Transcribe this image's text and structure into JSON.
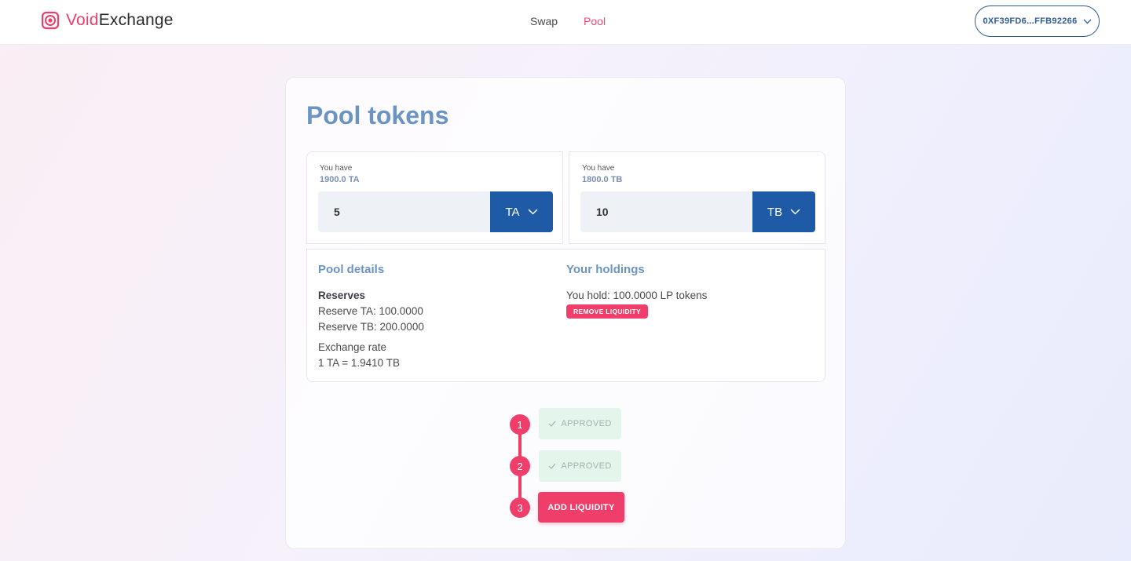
{
  "header": {
    "logo_prefix": "Void",
    "logo_suffix": "Exchange",
    "nav": [
      {
        "label": "Swap",
        "active": false
      },
      {
        "label": "Pool",
        "active": true
      }
    ],
    "wallet_address": "0XF39FD6...FFB92266"
  },
  "card": {
    "title": "Pool tokens",
    "token_a": {
      "you_have_label": "You have",
      "balance": "1900.0 TA",
      "amount": "5",
      "symbol": "TA"
    },
    "token_b": {
      "you_have_label": "You have",
      "balance": "1800.0 TB",
      "amount": "10",
      "symbol": "TB"
    },
    "pool_details": {
      "heading": "Pool details",
      "reserves_label": "Reserves",
      "reserve_a": "Reserve TA: 100.0000",
      "reserve_b": "Reserve TB: 200.0000",
      "exchange_rate_label": "Exchange rate",
      "exchange_rate": "1 TA = 1.9410 TB"
    },
    "holdings": {
      "heading": "Your holdings",
      "text": "You hold: 100.0000 LP tokens",
      "remove_label": "REMOVE LIQUIDITY"
    },
    "steps": [
      {
        "number": "1",
        "label": "APPROVED",
        "state": "done"
      },
      {
        "number": "2",
        "label": "APPROVED",
        "state": "done"
      },
      {
        "number": "3",
        "label": "ADD LIQUIDITY",
        "state": "active"
      }
    ]
  },
  "colors": {
    "accent": "#ef3e6a",
    "primary": "#1f5aa6",
    "heading": "#6b94c2"
  }
}
